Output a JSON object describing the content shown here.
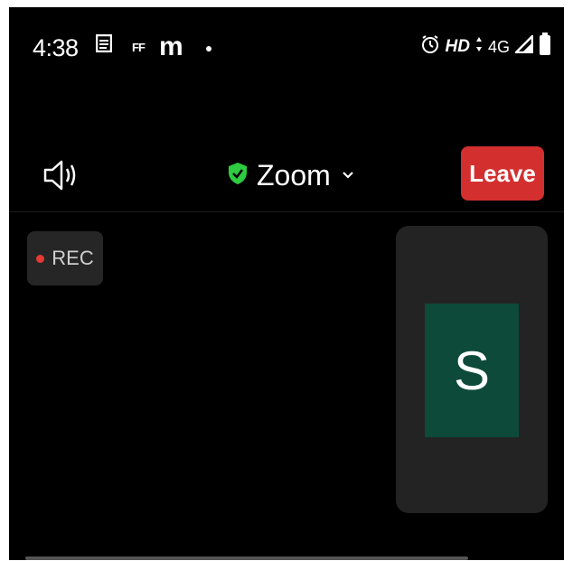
{
  "status_bar": {
    "time": "4:38",
    "ff": "FF",
    "m": "m",
    "hd": "HD",
    "network": "4G"
  },
  "header": {
    "title": "Zoom",
    "leave_label": "Leave",
    "colors": {
      "leave_bg": "#d32f2f",
      "shield": "#2ecc40"
    }
  },
  "recording": {
    "label": "REC"
  },
  "participant": {
    "initial": "S",
    "avatar_color": "#0d4a3a"
  }
}
